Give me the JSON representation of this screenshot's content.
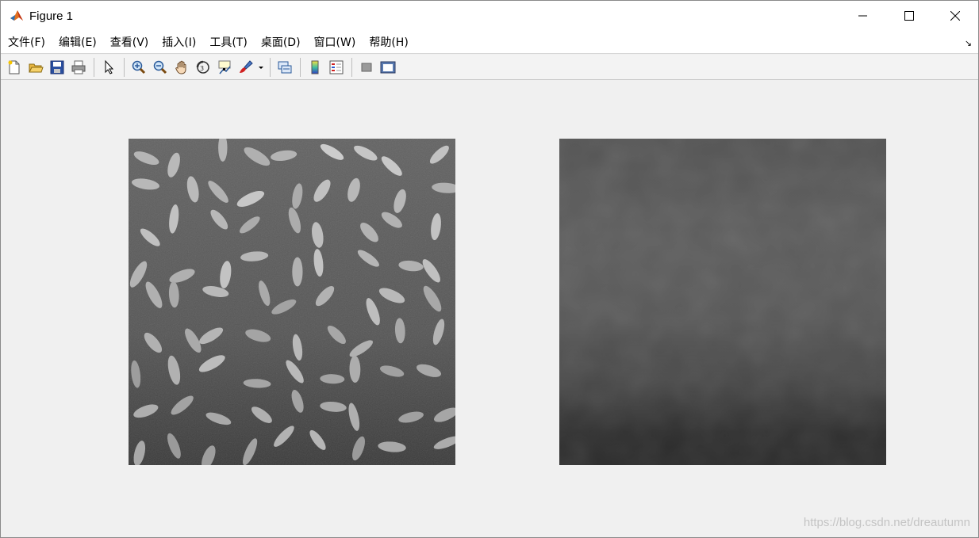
{
  "window": {
    "title": "Figure 1"
  },
  "menu": [
    "文件(F)",
    "编辑(E)",
    "查看(V)",
    "插入(I)",
    "工具(T)",
    "桌面(D)",
    "窗口(W)",
    "帮助(H)"
  ],
  "toolbar": {
    "groups": [
      [
        "new-figure-icon",
        "open-file-icon",
        "save-icon",
        "print-icon"
      ],
      [
        "select-arrow-icon"
      ],
      [
        "zoom-in-icon",
        "zoom-out-icon",
        "pan-hand-icon",
        "rotate-3d-icon",
        "data-cursor-icon",
        "brush-icon"
      ],
      [
        "link-plot-icon"
      ],
      [
        "colorbar-icon",
        "legend-icon"
      ],
      [
        "hide-plot-tools-icon",
        "show-plot-tools-icon"
      ]
    ]
  },
  "axes": [
    {
      "name": "axes-left",
      "content": "rice-grains-grayscale-image"
    },
    {
      "name": "axes-right",
      "content": "background-estimate-image"
    }
  ],
  "watermark": "https://blog.csdn.net/dreautumn"
}
